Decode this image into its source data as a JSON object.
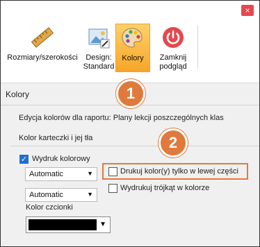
{
  "window": {
    "close_glyph": "×"
  },
  "ribbon": {
    "buttons": [
      {
        "label_line1": "Rozmiary/szerokości",
        "label_line2": "",
        "icon": "ruler-icon"
      },
      {
        "label_line1": "Design:",
        "label_line2": "Standard",
        "icon": "design-picture-icon"
      },
      {
        "label_line1": "Kolory",
        "label_line2": "",
        "icon": "palette-icon",
        "active": true
      },
      {
        "label_line1": "Zamknij",
        "label_line2": "podgląd",
        "icon": "power-icon"
      }
    ]
  },
  "badges": [
    "1",
    "2"
  ],
  "panel": {
    "title": "Kolory",
    "description": "Edycja kolorów dla raportu: Plany lekcji poszczególnych klas",
    "group_title": "Kolor karteczki i jej tła",
    "color_print": {
      "label": "Wydruk kolorowy",
      "checked": true
    },
    "dropdown1": {
      "value": "Automatic"
    },
    "dropdown2": {
      "value": "Automatic"
    },
    "left_part_only": {
      "label": "Drukuj kolor(y) tylko w lewej części",
      "checked": false
    },
    "triangle_color": {
      "label": "Wydrukuj trójkąt w kolorze",
      "checked": false
    },
    "font_color_label": "Kolor czcionki",
    "font_color_value": "#000000"
  },
  "colors": {
    "accent": "#e07a3c",
    "active_button": "#f8a528",
    "checkbox_on": "#1f6fd1"
  }
}
